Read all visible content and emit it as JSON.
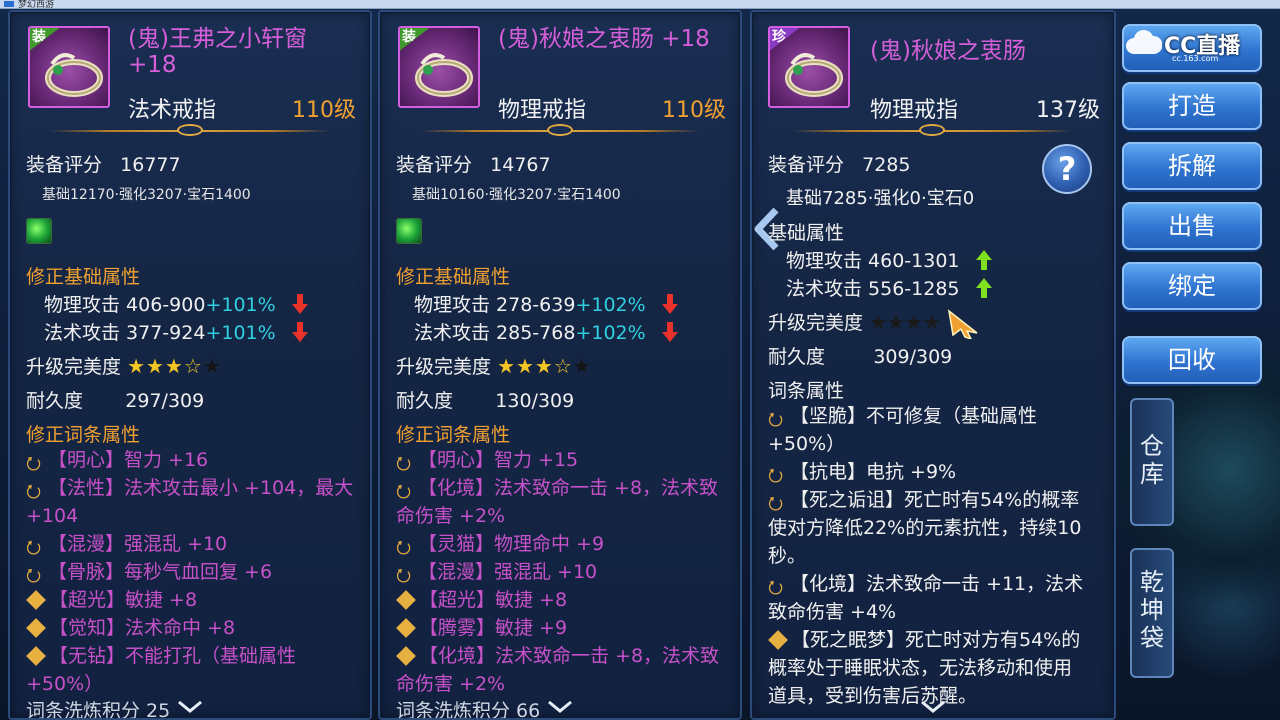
{
  "window": {
    "title": "梦幻西游"
  },
  "items": [
    {
      "badge": "装",
      "name": "(鬼)王弗之小轩窗 +18",
      "type": "法术戒指",
      "level": "110级",
      "score_label": "装备评分",
      "score": "16777",
      "score_breakdown": "基础12170·强化3207·宝石1400",
      "base_section": "修正基础属性",
      "base_attrs": [
        {
          "name": "物理攻击 406-900",
          "bonus": "+101%",
          "trend": "down"
        },
        {
          "name": "法术攻击 377-924",
          "bonus": "+101%",
          "trend": "down"
        }
      ],
      "perfection_label": "升级完美度",
      "perfection_stars": "3.5",
      "durability_label": "耐久度",
      "durability": "297/309",
      "affix_section": "修正词条属性",
      "affixes": [
        {
          "icon": "swirl",
          "text": "【明心】智力 +16"
        },
        {
          "icon": "swirl",
          "text": "【法性】法术攻击最小 +104，最大 +104"
        },
        {
          "icon": "swirl",
          "text": "【混漫】强混乱 +10"
        },
        {
          "icon": "swirl",
          "text": "【骨脉】每秒气血回复 +6"
        },
        {
          "icon": "diamond",
          "text": "【超光】敏捷 +8"
        },
        {
          "icon": "diamond",
          "text": "【觉知】法术命中 +8"
        },
        {
          "icon": "diamond",
          "text": "【无钻】不能打孔（基础属性 +50%）"
        }
      ],
      "refine_label": "词条洗炼积分 25"
    },
    {
      "badge": "装",
      "name": "(鬼)秋娘之衷肠 +18",
      "type": "物理戒指",
      "level": "110级",
      "score_label": "装备评分",
      "score": "14767",
      "score_breakdown": "基础10160·强化3207·宝石1400",
      "base_section": "修正基础属性",
      "base_attrs": [
        {
          "name": "物理攻击 278-639",
          "bonus": "+102%",
          "trend": "down"
        },
        {
          "name": "法术攻击 285-768",
          "bonus": "+102%",
          "trend": "down"
        }
      ],
      "perfection_label": "升级完美度",
      "perfection_stars": "3.5",
      "durability_label": "耐久度",
      "durability": "130/309",
      "affix_section": "修正词条属性",
      "affixes": [
        {
          "icon": "swirl",
          "text": "【明心】智力 +15"
        },
        {
          "icon": "swirl",
          "text": "【化境】法术致命一击 +8，法术致命伤害 +2%"
        },
        {
          "icon": "swirl",
          "text": "【灵猫】物理命中 +9"
        },
        {
          "icon": "swirl",
          "text": "【混漫】强混乱 +10"
        },
        {
          "icon": "diamond",
          "text": "【超光】敏捷 +8"
        },
        {
          "icon": "diamond",
          "text": "【腾雾】敏捷 +9"
        },
        {
          "icon": "diamond",
          "text": "【化境】法术致命一击 +8，法术致命伤害 +2%"
        }
      ],
      "refine_label": "词条洗炼积分 66"
    },
    {
      "badge": "珍",
      "name": "(鬼)秋娘之衷肠",
      "type": "物理戒指",
      "level": "137级",
      "score_label": "装备评分",
      "score": "7285",
      "score_breakdown": "基础7285·强化0·宝石0",
      "base_section": "基础属性",
      "base_attrs": [
        {
          "name": "物理攻击 460-1301",
          "trend": "up"
        },
        {
          "name": "法术攻击 556-1285",
          "trend": "up"
        }
      ],
      "perfection_label": "升级完美度",
      "durability_label": "耐久度",
      "durability": "309/309",
      "affix_section": "词条属性",
      "affixes": [
        {
          "icon": "swirl",
          "text": "【坚脆】不可修复（基础属性+50%）"
        },
        {
          "icon": "swirl",
          "text": "【抗电】电抗 +9%"
        },
        {
          "icon": "swirl",
          "text": "【死之诟诅】死亡时有54%的概率使对方降低22%的元素抗性，持续10秒。"
        },
        {
          "icon": "swirl",
          "text": "【化境】法术致命一击 +11，法术致命伤害 +4%"
        },
        {
          "icon": "diamond",
          "text": "【死之眠梦】死亡时对方有54%的概率处于睡眠状态，无法移动和使用道具，受到伤害后苏醒。"
        }
      ]
    }
  ],
  "help_label": "?",
  "side_buttons": [
    "打造",
    "拆解",
    "出售",
    "绑定",
    "回收"
  ],
  "side_tabs": [
    "仓库",
    "乾坤袋"
  ],
  "stream_logo": {
    "text": "CC直播",
    "sub": "cc.163.com"
  }
}
